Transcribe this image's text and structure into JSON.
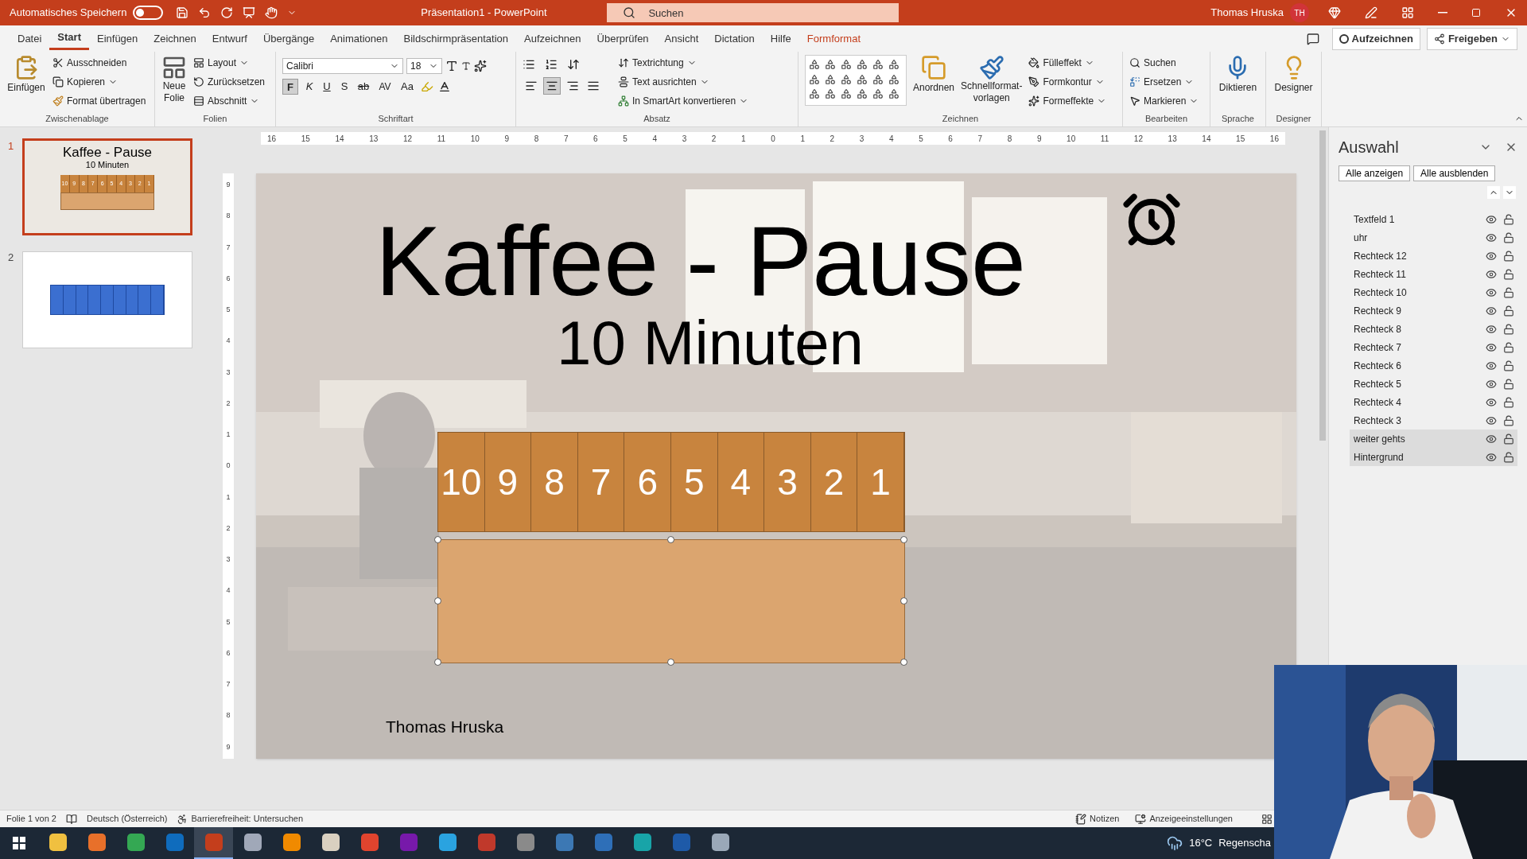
{
  "title_bar": {
    "autosave_label": "Automatisches Speichern",
    "autosave_on": false,
    "document_title": "Präsentation1  -  PowerPoint",
    "search_placeholder": "Suchen",
    "user_name": "Thomas Hruska",
    "user_initials": "TH"
  },
  "menu_tabs": [
    {
      "label": "Datei",
      "selected": false,
      "kind": "normal"
    },
    {
      "label": "Start",
      "selected": true,
      "kind": "normal"
    },
    {
      "label": "Einfügen",
      "selected": false,
      "kind": "normal"
    },
    {
      "label": "Zeichnen",
      "selected": false,
      "kind": "normal"
    },
    {
      "label": "Entwurf",
      "selected": false,
      "kind": "normal"
    },
    {
      "label": "Übergänge",
      "selected": false,
      "kind": "normal"
    },
    {
      "label": "Animationen",
      "selected": false,
      "kind": "normal"
    },
    {
      "label": "Bildschirmpräsentation",
      "selected": false,
      "kind": "normal"
    },
    {
      "label": "Aufzeichnen",
      "selected": false,
      "kind": "normal"
    },
    {
      "label": "Überprüfen",
      "selected": false,
      "kind": "normal"
    },
    {
      "label": "Ansicht",
      "selected": false,
      "kind": "normal"
    },
    {
      "label": "Dictation",
      "selected": false,
      "kind": "normal"
    },
    {
      "label": "Hilfe",
      "selected": false,
      "kind": "normal"
    },
    {
      "label": "Formformat",
      "selected": false,
      "kind": "contextual"
    }
  ],
  "record_button": "Aufzeichnen",
  "share_button": "Freigeben",
  "ribbon": {
    "clipboard": {
      "title": "Zwischenablage",
      "paste": "Einfügen",
      "items": [
        "Ausschneiden",
        "Kopieren",
        "Format übertragen"
      ]
    },
    "slides": {
      "title": "Folien",
      "new_slide": [
        "Neue",
        "Folie"
      ],
      "items": [
        "Layout",
        "Zurücksetzen",
        "Abschnitt"
      ]
    },
    "font": {
      "title": "Schriftart",
      "font_name": "Calibri",
      "font_size": "18",
      "bold": "F",
      "bold_on": true,
      "italic": "K",
      "underline": "U",
      "shadow": "S",
      "strike": "ab",
      "spacing": "AV",
      "case": "Aa"
    },
    "paragraph": {
      "title": "Absatz",
      "items": [
        "Textrichtung",
        "Text ausrichten",
        "In SmartArt konvertieren"
      ],
      "alignments": [
        {
          "selected": false
        },
        {
          "selected": true
        },
        {
          "selected": false
        },
        {
          "selected": false
        }
      ]
    },
    "drawing": {
      "title": "Zeichnen",
      "arrange": "Anordnen",
      "quick_styles": [
        "Schnellformat-",
        "vorlagen"
      ],
      "items": [
        "Fülleffekt",
        "Formkontur",
        "Formeffekte"
      ]
    },
    "editing": {
      "title": "Bearbeiten",
      "items": [
        "Suchen",
        "Ersetzen",
        "Markieren"
      ]
    },
    "voice": {
      "title": "Sprache",
      "dictate": "Diktieren"
    },
    "designer": {
      "title": "Designer",
      "button": "Designer"
    }
  },
  "thumbnails": [
    {
      "number": "1",
      "selected": true,
      "kind": "title",
      "title": "Kaffee - Pause",
      "subtitle": "10 Minuten",
      "numbers": [
        "10",
        "9",
        "8",
        "7",
        "6",
        "5",
        "4",
        "3",
        "2",
        "1"
      ]
    },
    {
      "number": "2",
      "selected": false,
      "kind": "blocks"
    }
  ],
  "ruler": {
    "horizontal": [
      "16",
      "15",
      "14",
      "13",
      "12",
      "11",
      "10",
      "9",
      "8",
      "7",
      "6",
      "5",
      "4",
      "3",
      "2",
      "1",
      "0",
      "1",
      "2",
      "3",
      "4",
      "5",
      "6",
      "7",
      "8",
      "9",
      "10",
      "11",
      "12",
      "13",
      "14",
      "15",
      "16"
    ],
    "vertical": [
      "9",
      "8",
      "7",
      "6",
      "5",
      "4",
      "3",
      "2",
      "1",
      "0",
      "1",
      "2",
      "3",
      "4",
      "5",
      "6",
      "7",
      "8",
      "9"
    ]
  },
  "slide": {
    "title": "Kaffee - Pause",
    "subtitle": "10 Minuten",
    "numbers": [
      "10",
      "9",
      "8",
      "7",
      "6",
      "5",
      "4",
      "3",
      "2",
      "1"
    ],
    "panel_selected": true,
    "author": "Thomas Hruska"
  },
  "selection_pane": {
    "title": "Auswahl",
    "buttons": [
      "Alle anzeigen",
      "Alle ausblenden"
    ],
    "items": [
      {
        "name": "Textfeld 1",
        "selected": false
      },
      {
        "name": "uhr",
        "selected": false
      },
      {
        "name": "Rechteck 12",
        "selected": false
      },
      {
        "name": "Rechteck 11",
        "selected": false
      },
      {
        "name": "Rechteck 10",
        "selected": false
      },
      {
        "name": "Rechteck 9",
        "selected": false
      },
      {
        "name": "Rechteck 8",
        "selected": false
      },
      {
        "name": "Rechteck 7",
        "selected": false
      },
      {
        "name": "Rechteck 6",
        "selected": false
      },
      {
        "name": "Rechteck 5",
        "selected": false
      },
      {
        "name": "Rechteck 4",
        "selected": false
      },
      {
        "name": "Rechteck 3",
        "selected": false
      },
      {
        "name": "weiter gehts",
        "selected": true
      },
      {
        "name": "Hintergrund",
        "selected": true
      }
    ]
  },
  "status_bar": {
    "slide_info": "Folie 1 von 2",
    "language": "Deutsch (Österreich)",
    "accessibility": "Barrierefreiheit: Untersuchen",
    "notes": "Notizen",
    "display_settings": "Anzeigeeinstellungen"
  },
  "taskbar": {
    "apps": [
      {
        "color": "#f0c040",
        "selected": false
      },
      {
        "color": "#e8702a",
        "selected": false
      },
      {
        "color": "#34a853",
        "selected": false
      },
      {
        "color": "#0f6cbd",
        "selected": false
      },
      {
        "color": "#c43e1c",
        "selected": true
      },
      {
        "color": "#a0a8b8",
        "selected": false
      },
      {
        "color": "#f08a00",
        "selected": false
      },
      {
        "color": "#d9d0c0",
        "selected": false
      },
      {
        "color": "#e0442e",
        "selected": false
      },
      {
        "color": "#7719aa",
        "selected": false
      },
      {
        "color": "#2aa3e0",
        "selected": false
      },
      {
        "color": "#c0392b",
        "selected": false
      },
      {
        "color": "#8a8a8a",
        "selected": false
      },
      {
        "color": "#3c78b4",
        "selected": false
      },
      {
        "color": "#2e6fb8",
        "selected": false
      },
      {
        "color": "#18a4a8",
        "selected": false
      },
      {
        "color": "#1e5aa8",
        "selected": false
      },
      {
        "color": "#9aa8b8",
        "selected": false
      }
    ],
    "temperature": "16°C",
    "weather": "Regenscha"
  }
}
